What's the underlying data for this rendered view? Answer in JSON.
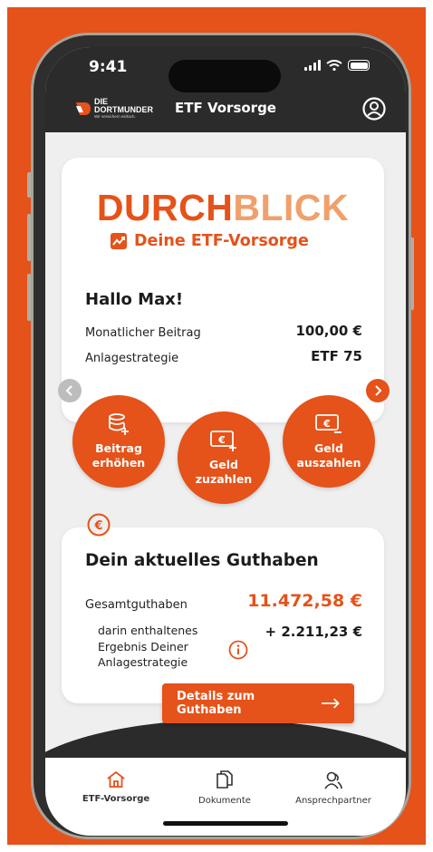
{
  "status_bar": {
    "time": "9:41"
  },
  "header": {
    "logo_brand_line1": "DIE",
    "logo_brand_line2": "DORTMUNDER",
    "logo_tagline": "Wir versichern einfach.",
    "title": "ETF Vorsorge",
    "profile_icon": "user-circle-icon"
  },
  "brand": {
    "part1": "DURCH",
    "part2": "BLICK",
    "subtitle": "Deine ETF-Vorsorge",
    "subtitle_icon": "chart-trend-icon"
  },
  "overview": {
    "greeting": "Hallo Max!",
    "rows": [
      {
        "label": "Monatlicher Beitrag",
        "value": "100,00 €"
      },
      {
        "label": "Anlagestrategie",
        "value": "ETF 75"
      }
    ]
  },
  "carousel": {
    "prev_icon": "chevron-left-icon",
    "next_icon": "chevron-right-icon"
  },
  "actions": [
    {
      "line1": "Beitrag",
      "line2": "erhöhen",
      "icon": "database-plus-icon"
    },
    {
      "line1": "Geld",
      "line2": "zuzahlen",
      "icon": "euro-card-plus-icon"
    },
    {
      "line1": "Geld",
      "line2": "auszahlen",
      "icon": "euro-card-minus-icon"
    }
  ],
  "balance": {
    "badge_icon": "euro-circle-icon",
    "title": "Dein aktuelles Guthaben",
    "total_label": "Gesamtguthaben",
    "total_value": "11.472,58 €",
    "sub_label_line1": "darin enthaltenes",
    "sub_label_line2": "Ergebnis Deiner",
    "sub_label_line3": "Anlagestrategie",
    "sub_value": "+ 2.211,23 €",
    "info_icon": "info-icon",
    "details_button": "Details zum Guthaben"
  },
  "tabbar": {
    "tabs": [
      {
        "label": "ETF-Vorsorge",
        "icon": "home-icon",
        "active": true
      },
      {
        "label": "Dokumente",
        "icon": "documents-icon",
        "active": false
      },
      {
        "label": "Ansprechpartner",
        "icon": "contact-person-icon",
        "active": false
      }
    ]
  },
  "colors": {
    "accent": "#e5521a",
    "accent_light": "#f0a06a",
    "dark": "#2b2b2b",
    "background": "#efefef"
  }
}
